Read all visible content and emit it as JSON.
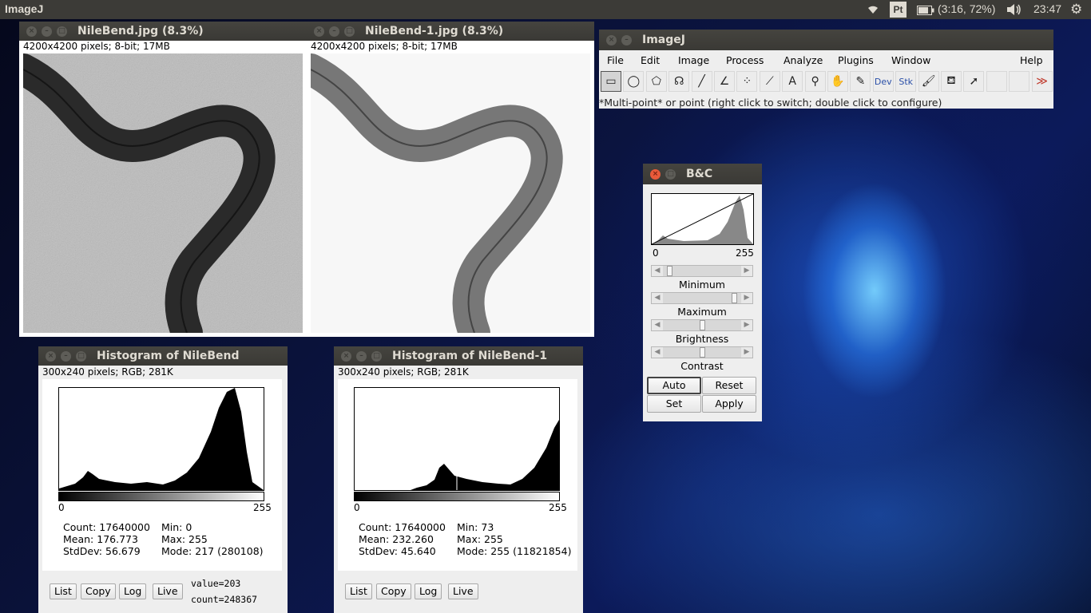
{
  "top_panel": {
    "app_title": "ImageJ",
    "keyboard_layout": "Pt",
    "battery": "(3:16, 72%)",
    "clock": "23:47"
  },
  "image_windows": [
    {
      "title": "NileBend.jpg (8.3%)",
      "info": "4200x4200 pixels; 8-bit; 17MB",
      "variant": "original"
    },
    {
      "title": "NileBend-1.jpg (8.3%)",
      "info": "4200x4200 pixels; 8-bit; 17MB",
      "variant": "contrast"
    }
  ],
  "histogram_windows": [
    {
      "title": "Histogram of NileBend",
      "info": "300x240 pixels; RGB; 281K",
      "axis_min": "0",
      "axis_max": "255",
      "count": "Count: 17640000",
      "mean": "Mean: 176.773",
      "stddev": "StdDev: 56.679",
      "min": "Min: 0",
      "max": "Max: 255",
      "mode": "Mode: 217 (280108)",
      "buttons": [
        "List",
        "Copy",
        "Log",
        "Live"
      ],
      "value": "value=203",
      "countval": "count=248367"
    },
    {
      "title": "Histogram of NileBend-1",
      "info": "300x240 pixels; RGB; 281K",
      "axis_min": "0",
      "axis_max": "255",
      "count": "Count: 17640000",
      "mean": "Mean: 232.260",
      "stddev": "StdDev: 45.640",
      "min": "Min: 73",
      "max": "Max: 255",
      "mode": "Mode: 255 (11821854)",
      "buttons": [
        "List",
        "Copy",
        "Log",
        "Live"
      ]
    }
  ],
  "imagej": {
    "title": "ImageJ",
    "menus": [
      "File",
      "Edit",
      "Image",
      "Process",
      "Analyze",
      "Plugins",
      "Window",
      "Help"
    ],
    "tools": [
      {
        "name": "rectangle-tool",
        "glyph": "▭",
        "selected": true
      },
      {
        "name": "oval-tool",
        "glyph": "◯"
      },
      {
        "name": "polygon-tool",
        "glyph": "⬠"
      },
      {
        "name": "freehand-tool",
        "glyph": "☊"
      },
      {
        "name": "line-tool",
        "glyph": "╱"
      },
      {
        "name": "angle-tool",
        "glyph": "∠"
      },
      {
        "name": "multipoint-tool",
        "glyph": "⁘"
      },
      {
        "name": "wand-tool",
        "glyph": "⟋"
      },
      {
        "name": "text-tool",
        "glyph": "A"
      },
      {
        "name": "magnifier-tool",
        "glyph": "⚲"
      },
      {
        "name": "hand-tool",
        "glyph": "✋"
      },
      {
        "name": "dropper-tool",
        "glyph": "✎"
      },
      {
        "name": "dev-tool",
        "glyph": "Dev"
      },
      {
        "name": "stk-tool",
        "glyph": "Stk"
      },
      {
        "name": "brush-tool",
        "glyph": "🖌"
      },
      {
        "name": "flood-fill-tool",
        "glyph": "⛾"
      },
      {
        "name": "arrow-tool",
        "glyph": "➚"
      },
      {
        "name": "empty-slot-1",
        "glyph": ""
      },
      {
        "name": "empty-slot-2",
        "glyph": ""
      },
      {
        "name": "more-tools",
        "glyph": "≫"
      }
    ],
    "status": "*Multi-point* or point (right click to switch; double click to configure)"
  },
  "bc": {
    "title": "B&C",
    "axis_min": "0",
    "axis_max": "255",
    "sliders": [
      {
        "label": "Minimum",
        "level": 0.05
      },
      {
        "label": "Maximum",
        "level": 0.95
      },
      {
        "label": "Brightness",
        "level": 0.5
      },
      {
        "label": "Contrast",
        "level": 0.5
      }
    ],
    "buttons": [
      "Auto",
      "Reset",
      "Set",
      "Apply"
    ]
  }
}
